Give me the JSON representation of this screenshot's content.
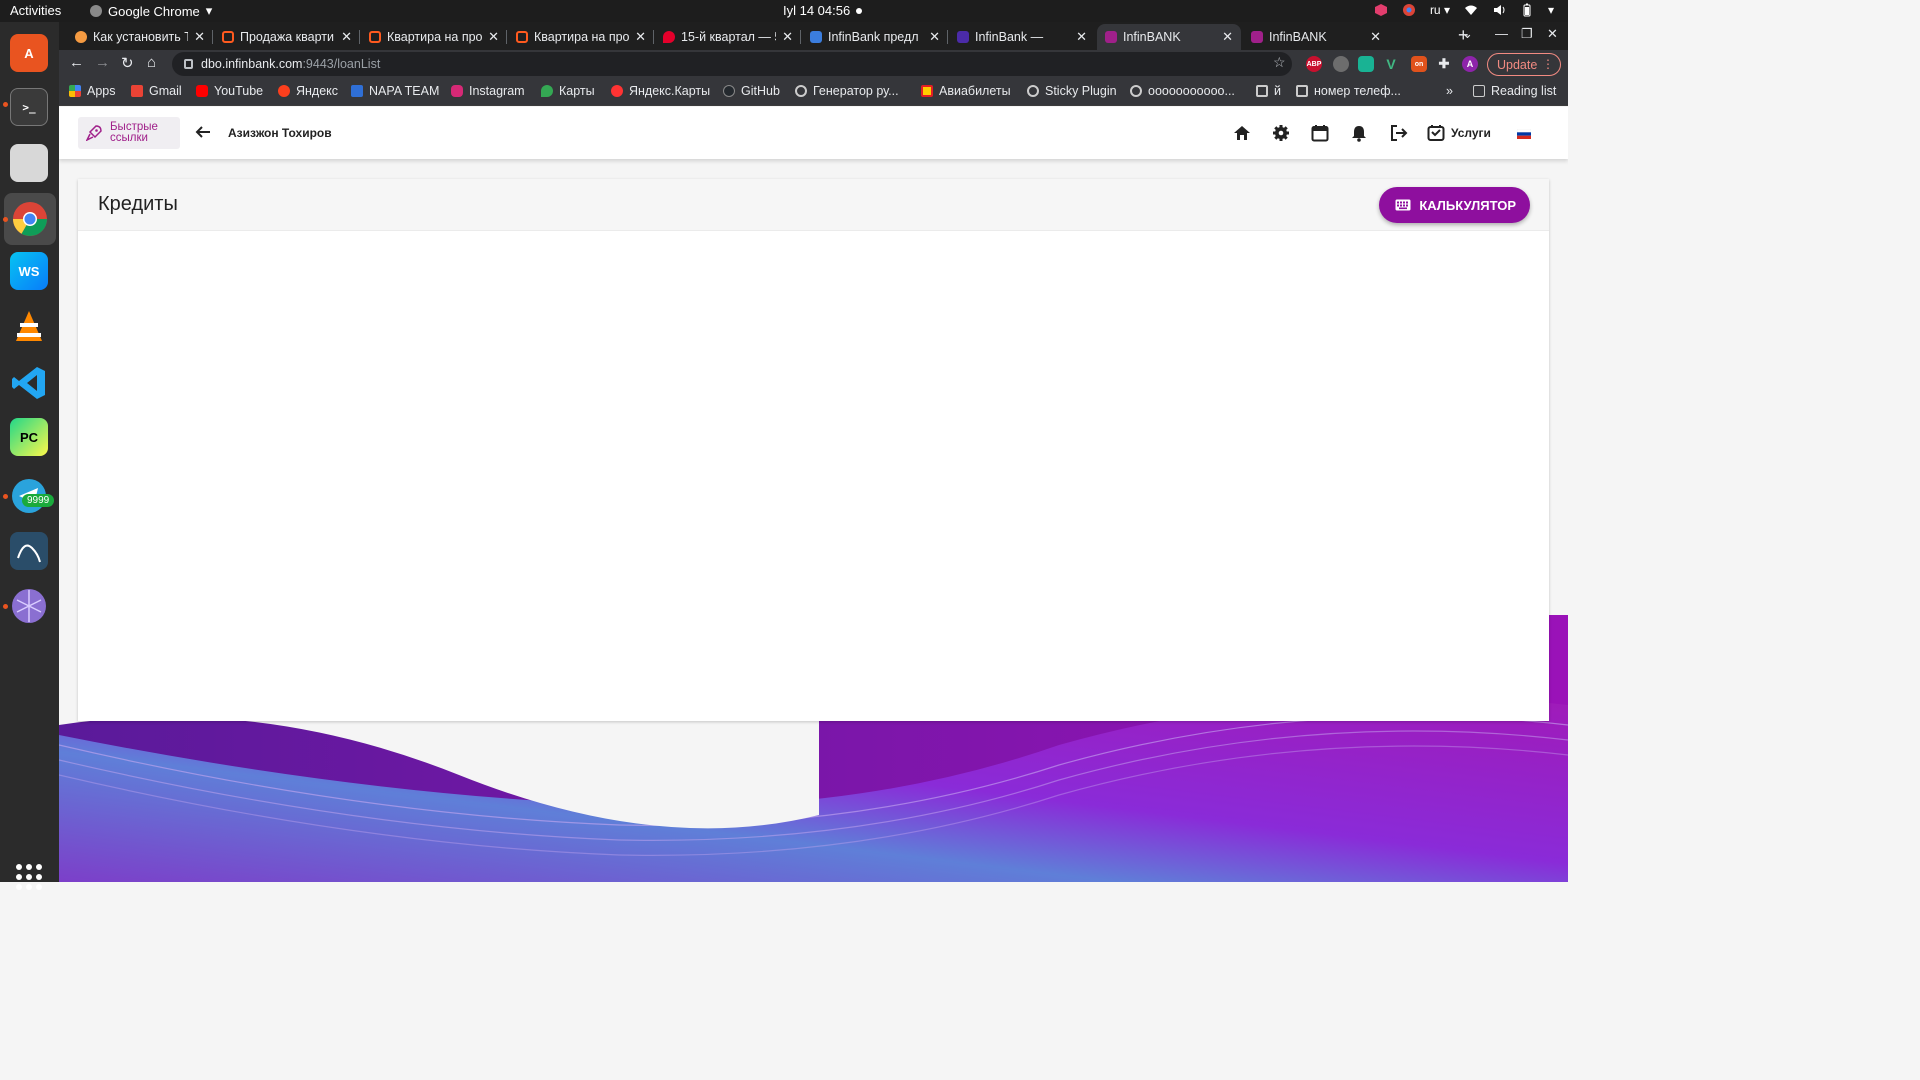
{
  "os": {
    "activities": "Activities",
    "app_name": "Google Chrome",
    "clock": "Iyl 14  04:56",
    "lang": "ru"
  },
  "dock": {
    "badge": "9999",
    "items": [
      "ubuntu-software",
      "terminal",
      "files",
      "chrome",
      "webstorm",
      "vlc",
      "vscode",
      "pycharm",
      "telegram",
      "mysql-workbench",
      "network-tool"
    ]
  },
  "tabs": [
    {
      "title": "Как установить Т",
      "color": "#f59b42"
    },
    {
      "title": "Продажа кварти",
      "color": "#ff5a1f"
    },
    {
      "title": "Квартира на про",
      "color": "#ff5a1f"
    },
    {
      "title": "Квартира на про",
      "color": "#ff5a1f"
    },
    {
      "title": "15-й квартал — 5",
      "color": "#e5002b"
    },
    {
      "title": "InfinBank предл",
      "color": "#3b7ddd"
    },
    {
      "title": "InfinBank —",
      "color": "#4b2ba8"
    },
    {
      "title": "InfinBANK",
      "color": "#a0208a"
    },
    {
      "title": "InfinBANK",
      "color": "#a0208a"
    }
  ],
  "address": {
    "host": "dbo.infinbank.com",
    "path": ":9443/loanList"
  },
  "toolbar": {
    "update_label": "Update",
    "extensions": [
      {
        "name": "abp",
        "text": "ABP",
        "color": "#c8102e"
      },
      {
        "name": "ext-gray",
        "text": "",
        "color": "#6d6d6d"
      },
      {
        "name": "ext-green",
        "text": "",
        "color": "#19b394"
      },
      {
        "name": "vue-devtools",
        "text": "V",
        "color": "#41b883"
      },
      {
        "name": "ext-on",
        "text": "on",
        "color": "#e0521c"
      },
      {
        "name": "ext-puzzle",
        "text": "",
        "color": "#35363a"
      },
      {
        "name": "profile",
        "text": "A",
        "color": "#8e24aa"
      }
    ]
  },
  "bookmarks": [
    {
      "label": "Apps",
      "color": "#4285f4"
    },
    {
      "label": "Gmail",
      "color": "#ea4335"
    },
    {
      "label": "YouTube",
      "color": "#ff0000"
    },
    {
      "label": "Яндекс",
      "color": "#fc3f1d"
    },
    {
      "label": "NAPA TEAM",
      "color": "#2f6fd6"
    },
    {
      "label": "Instagram",
      "color": "#d62976"
    },
    {
      "label": "Карты",
      "color": "#34a853"
    },
    {
      "label": "Яндекс.Карты",
      "color": "#ff3333"
    },
    {
      "label": "GitHub",
      "color": "#24292e"
    },
    {
      "label": "Генератор ру...",
      "color": "#cccccc"
    },
    {
      "label": "Авиабилеты",
      "color": "#ffcc00"
    },
    {
      "label": "Sticky Plugin",
      "color": "#cccccc"
    },
    {
      "label": "ооооооооооо...",
      "color": "#cccccc"
    },
    {
      "label": "й",
      "color": "#cccccc"
    },
    {
      "label": "номер телеф...",
      "color": "#cccccc"
    }
  ],
  "reading_list": "Reading list",
  "app": {
    "quick_links": "Быстрые ссылки",
    "user_name": "Азизжон Тохиров",
    "services": "Услуги",
    "accent": "#8e0f9e"
  },
  "card": {
    "title": "Кредиты",
    "calculator": "КАЛЬКУЛЯТОР"
  }
}
